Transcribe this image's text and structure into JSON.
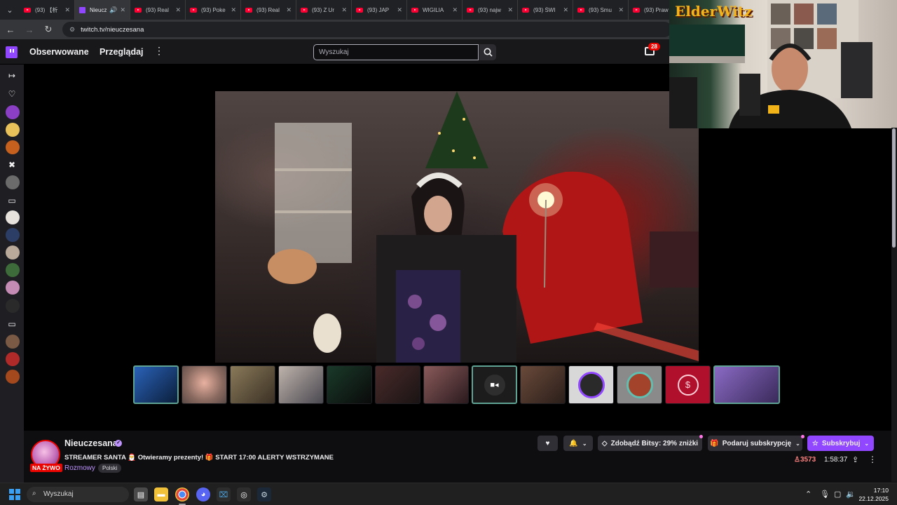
{
  "browser": {
    "tabs": [
      {
        "title": "(93) 【析",
        "kind": "youtube"
      },
      {
        "title": "Nieuczesana",
        "kind": "twitch",
        "active": true
      },
      {
        "title": "(93) Real",
        "kind": "youtube"
      },
      {
        "title": "(93) Poke",
        "kind": "youtube"
      },
      {
        "title": "(93) Real",
        "kind": "youtube"
      },
      {
        "title": "(93) Z Ur",
        "kind": "youtube"
      },
      {
        "title": "(93) JAP",
        "kind": "youtube"
      },
      {
        "title": "WIGILIA",
        "kind": "youtube"
      },
      {
        "title": "(93) najw",
        "kind": "youtube"
      },
      {
        "title": "(93) ŚWI",
        "kind": "youtube"
      },
      {
        "title": "(93) Smu",
        "kind": "youtube"
      },
      {
        "title": "(93) Praw",
        "kind": "youtube"
      }
    ],
    "url": "twitch.tv/nieuczesana"
  },
  "topnav": {
    "following": "Obserwowane",
    "browse": "Przeglądaj",
    "search_placeholder": "Wyszukaj",
    "inbox_count": "28"
  },
  "overlay": {
    "title": "ElderWitz"
  },
  "channel": {
    "name": "Nieuczesana",
    "live_label": "NA ŻYWO",
    "stream_title": "STREAMER SANTA 🎅 Otwieramy prezenty! 🎁 START 17:00 ALERTY WSTRZYMANE",
    "category": "Rozmowy",
    "language_tag": "Polski",
    "viewers": "3573",
    "uptime": "1:58:37"
  },
  "actions": {
    "bits_label": "Zdobądź Bitsy: 29% zniżki",
    "gift_label": "Podaruj subskrypcję",
    "subscribe_label": "Subskrybuj"
  },
  "taskbar": {
    "search_placeholder": "Wyszukaj",
    "time": "17:10",
    "date": "22.12.2025"
  },
  "colors": {
    "twitch_purple": "#9147ff",
    "live_red": "#eb0400",
    "background": "#0e0e10"
  }
}
